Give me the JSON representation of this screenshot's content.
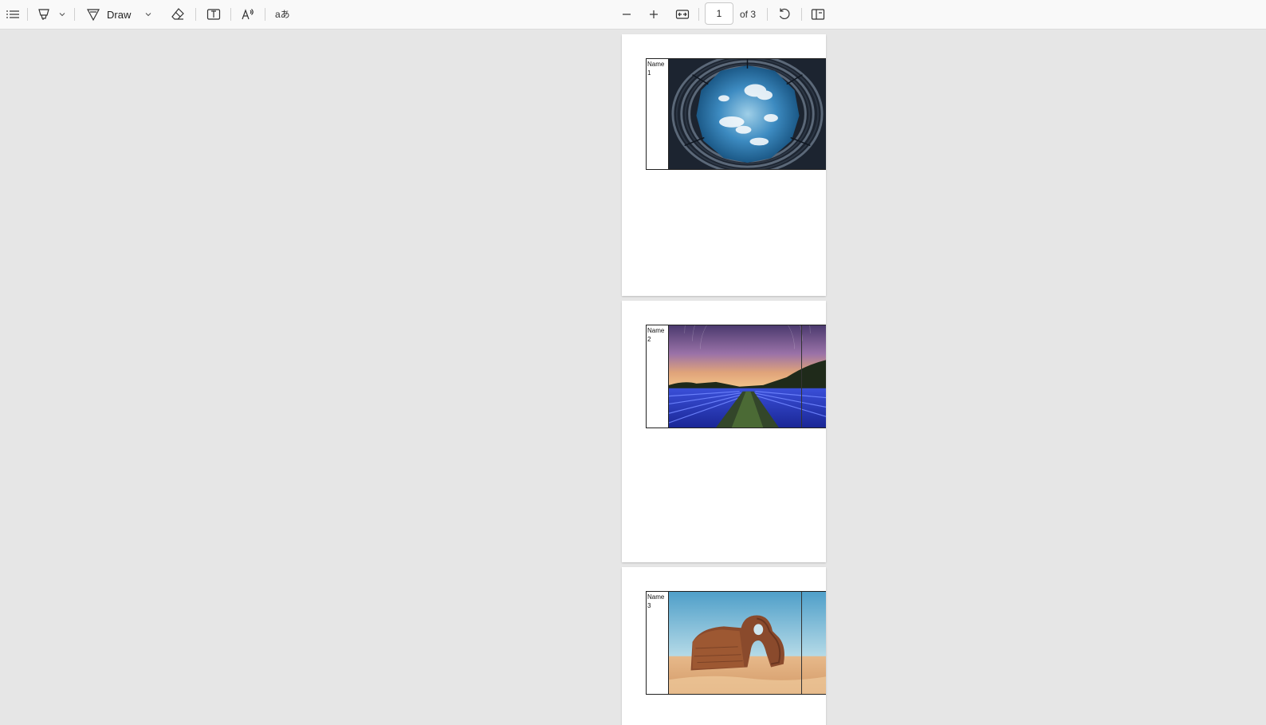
{
  "toolbar": {
    "draw_label": "Draw",
    "page_number": "1",
    "page_count": "of 3",
    "icons": [
      "contents-icon",
      "highlight-icon",
      "draw-icon",
      "eraser-icon",
      "text-box-icon",
      "read-aloud-icon",
      "translate-icon",
      "zoom-out-icon",
      "zoom-in-icon",
      "fit-width-icon",
      "rotate-icon",
      "page-view-icon"
    ]
  },
  "pages": [
    {
      "name_label": "Name",
      "number_label": "1",
      "photo": "sky-through-building-photo"
    },
    {
      "name_label": "Name",
      "number_label": "2",
      "photo": "lavender-field-night-photo"
    },
    {
      "name_label": "Name",
      "number_label": "3",
      "photo": "desert-rock-arch-photo"
    }
  ],
  "colors": {
    "toolbar_bg": "#f9f9f9",
    "canvas_bg": "#e6e6e6",
    "page_bg": "#ffffff"
  }
}
